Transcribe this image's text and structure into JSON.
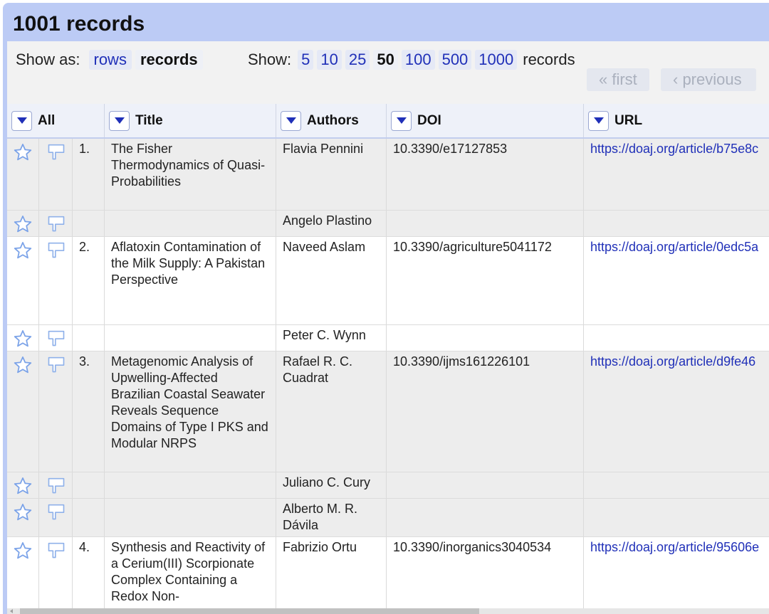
{
  "header": {
    "title": "1001 records"
  },
  "show_as": {
    "label": "Show as:",
    "options": [
      "rows",
      "records"
    ],
    "active": "records"
  },
  "show_count": {
    "label": "Show:",
    "options": [
      "5",
      "10",
      "25",
      "50",
      "100",
      "500",
      "1000"
    ],
    "active": "50",
    "suffix": "records"
  },
  "pager": {
    "first": "« first",
    "previous": "‹ previous"
  },
  "columns": {
    "all": "All",
    "title": "Title",
    "authors": "Authors",
    "doi": "DOI",
    "url": "URL"
  },
  "icons": {
    "star": "star-icon",
    "flag": "flag-icon",
    "dropdown": "triangle-down-icon"
  },
  "colors": {
    "accent": "#2030b8",
    "panel": "#bccbf5",
    "star_outline": "#7aa2e8"
  },
  "rows": [
    {
      "num": "1.",
      "title": "The Fisher Thermodynamics of Quasi-Probabilities",
      "author": "Flavia Pennini",
      "doi": "10.3390/e17127853",
      "url": "https://doaj.org/article/b75e8c"
    },
    {
      "num": "",
      "title": "",
      "author": "Angelo Plastino",
      "doi": "",
      "url": ""
    },
    {
      "num": "2.",
      "title": "Aflatoxin Contamination of the Milk Supply: A Pakistan Perspective",
      "author": "Naveed Aslam",
      "doi": "10.3390/agriculture5041172",
      "url": "https://doaj.org/article/0edc5a"
    },
    {
      "num": "",
      "title": "",
      "author": "Peter C. Wynn",
      "doi": "",
      "url": ""
    },
    {
      "num": "3.",
      "title": "Metagenomic Analysis of Upwelling-Affected Brazilian Coastal Seawater Reveals Sequence Domains of Type I PKS and Modular NRPS",
      "author": "Rafael R. C. Cuadrat",
      "doi": "10.3390/ijms161226101",
      "url": "https://doaj.org/article/d9fe46"
    },
    {
      "num": "",
      "title": "",
      "author": "Juliano C. Cury",
      "doi": "",
      "url": ""
    },
    {
      "num": "",
      "title": "",
      "author": "Alberto M. R. Dávila",
      "doi": "",
      "url": ""
    },
    {
      "num": "4.",
      "title": "Synthesis and Reactivity of a Cerium(III) Scorpionate Complex Containing a Redox Non-",
      "author": "Fabrizio Ortu",
      "doi": "10.3390/inorganics3040534",
      "url": "https://doaj.org/article/95606e"
    }
  ]
}
